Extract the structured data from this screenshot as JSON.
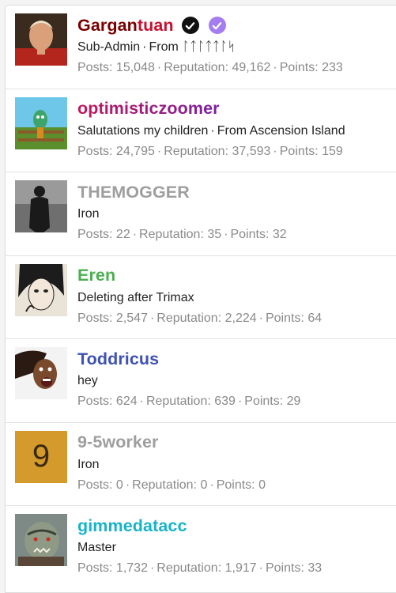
{
  "users": [
    {
      "name_part1": "Gargan",
      "name_part2": "tuan",
      "name_color": "#7a0000",
      "name_color2": "#c8102e",
      "title": "Sub-Admin",
      "location_prefix": "From",
      "location": "ᛚᛏᛚᛏᛏᛚᛋ",
      "badges": [
        "verified-black-icon",
        "verified-purple-icon"
      ],
      "stats": {
        "posts_label": "Posts:",
        "posts": "15,048",
        "rep_label": "Reputation:",
        "rep": "49,162",
        "points_label": "Points:",
        "points": "233"
      }
    },
    {
      "name": "optimisticzoomer",
      "name_color": "#b71c8c",
      "title": "Salutations my children",
      "location_prefix": "From",
      "location": "Ascension Island",
      "stats": {
        "posts_label": "Posts:",
        "posts": "24,795",
        "rep_label": "Reputation:",
        "rep": "37,593",
        "points_label": "Points:",
        "points": "159"
      }
    },
    {
      "name": "THEMOGGER",
      "name_color": "#9e9e9e",
      "title": "Iron",
      "stats": {
        "posts_label": "Posts:",
        "posts": "22",
        "rep_label": "Reputation:",
        "rep": "35",
        "points_label": "Points:",
        "points": "32"
      }
    },
    {
      "name": "Eren",
      "name_color": "#4caf50",
      "title": "Deleting after Trimax",
      "stats": {
        "posts_label": "Posts:",
        "posts": "2,547",
        "rep_label": "Reputation:",
        "rep": "2,224",
        "points_label": "Points:",
        "points": "64"
      }
    },
    {
      "name": "Toddricus",
      "name_color": "#3f51b5",
      "title": "hey",
      "stats": {
        "posts_label": "Posts:",
        "posts": "624",
        "rep_label": "Reputation:",
        "rep": "639",
        "points_label": "Points:",
        "points": "29"
      }
    },
    {
      "name": "9-5worker",
      "name_color": "#9e9e9e",
      "title": "Iron",
      "avatar_letter": "9",
      "avatar_bg": "#d59a2c",
      "stats": {
        "posts_label": "Posts:",
        "posts": "0",
        "rep_label": "Reputation:",
        "rep": "0",
        "points_label": "Points:",
        "points": "0"
      }
    },
    {
      "name": "gimmedatacc",
      "name_color": "#17b3c9",
      "title": "Master",
      "stats": {
        "posts_label": "Posts:",
        "posts": "1,732",
        "rep_label": "Reputation:",
        "rep": "1,917",
        "points_label": "Points:",
        "points": "33"
      }
    }
  ],
  "separator": "·"
}
